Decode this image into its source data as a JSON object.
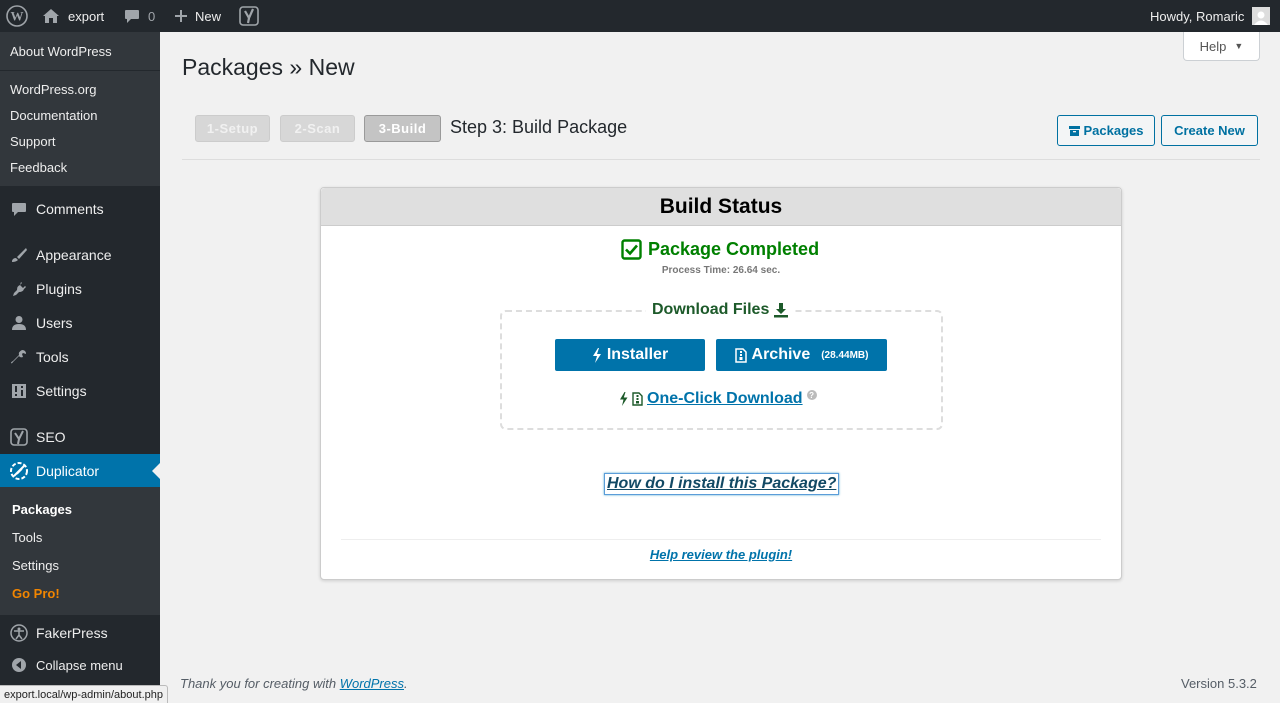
{
  "adminbar": {
    "site_name": "export",
    "comments_count": "0",
    "new_label": "New",
    "greeting": "Howdy, Romaric"
  },
  "sidebar": {
    "wp_submenu": [
      "About WordPress",
      "WordPress.org",
      "Documentation",
      "Support",
      "Feedback"
    ],
    "items": {
      "comments": "Comments",
      "appearance": "Appearance",
      "plugins": "Plugins",
      "users": "Users",
      "tools": "Tools",
      "settings": "Settings",
      "seo": "SEO",
      "duplicator": "Duplicator",
      "fakerpress": "FakerPress",
      "collapse": "Collapse menu"
    },
    "duplicator_submenu": {
      "packages": "Packages",
      "tools": "Tools",
      "settings": "Settings",
      "gopro": "Go Pro!"
    }
  },
  "help_label": "Help",
  "page_title": "Packages » New",
  "steps": [
    "1-Setup",
    "2-Scan",
    "3-Build"
  ],
  "step_title": "Step 3: Build Package",
  "buttons": {
    "packages": "Packages",
    "create_new": "Create New"
  },
  "build": {
    "header": "Build Status",
    "completed": "Package Completed",
    "process_time": "Process Time: 26.64 sec.",
    "download_legend": "Download Files",
    "installer": "Installer",
    "archive": "Archive",
    "archive_size": "(28.44MB)",
    "one_click": "One-Click Download",
    "howto": "How do I install this Package?",
    "review": "Help review the plugin!"
  },
  "footer": {
    "thanks_prefix": "Thank you for creating with ",
    "wordpress_link": "WordPress",
    "thanks_suffix": ".",
    "version": "Version 5.3.2"
  },
  "statusbar_url": "export.local/wp-admin/about.php",
  "colors": {
    "adminbar_bg": "#23282d",
    "accent": "#0073aa",
    "success": "#008000",
    "gopro": "#f18500"
  }
}
